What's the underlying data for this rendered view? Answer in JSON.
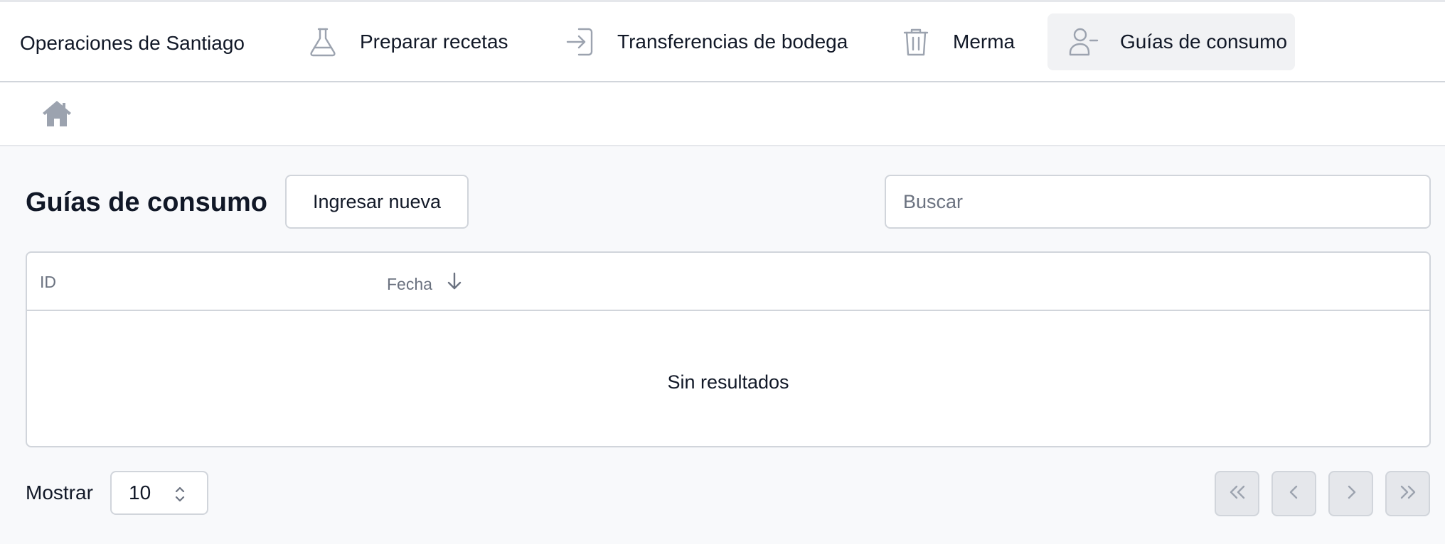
{
  "app": {
    "title": "Operaciones de Santiago"
  },
  "nav": {
    "items": [
      {
        "label": "Preparar recetas",
        "icon": "flask-icon"
      },
      {
        "label": "Transferencias de bodega",
        "icon": "login-arrow-icon"
      },
      {
        "label": "Merma",
        "icon": "trash-icon"
      },
      {
        "label": "Guías de consumo",
        "icon": "user-minus-icon",
        "active": true
      }
    ]
  },
  "breadcrumb": {
    "icon": "home-icon"
  },
  "page": {
    "title": "Guías de consumo",
    "new_button": "Ingresar nueva",
    "search_placeholder": "Buscar"
  },
  "table": {
    "columns": [
      {
        "label": "ID"
      },
      {
        "label": "Fecha",
        "sort": "desc",
        "icon": "arrow-down-icon"
      }
    ],
    "empty_text": "Sin resultados"
  },
  "pagination": {
    "show_label": "Mostrar",
    "page_size": "10",
    "buttons": [
      "first-page",
      "previous-page",
      "next-page",
      "last-page"
    ]
  },
  "colors": {
    "text": "#111827",
    "muted": "#6b7280",
    "icon": "#9ca3af",
    "border": "#d1d5db",
    "background": "#f8f9fb",
    "active_nav_bg": "#f1f2f4"
  }
}
